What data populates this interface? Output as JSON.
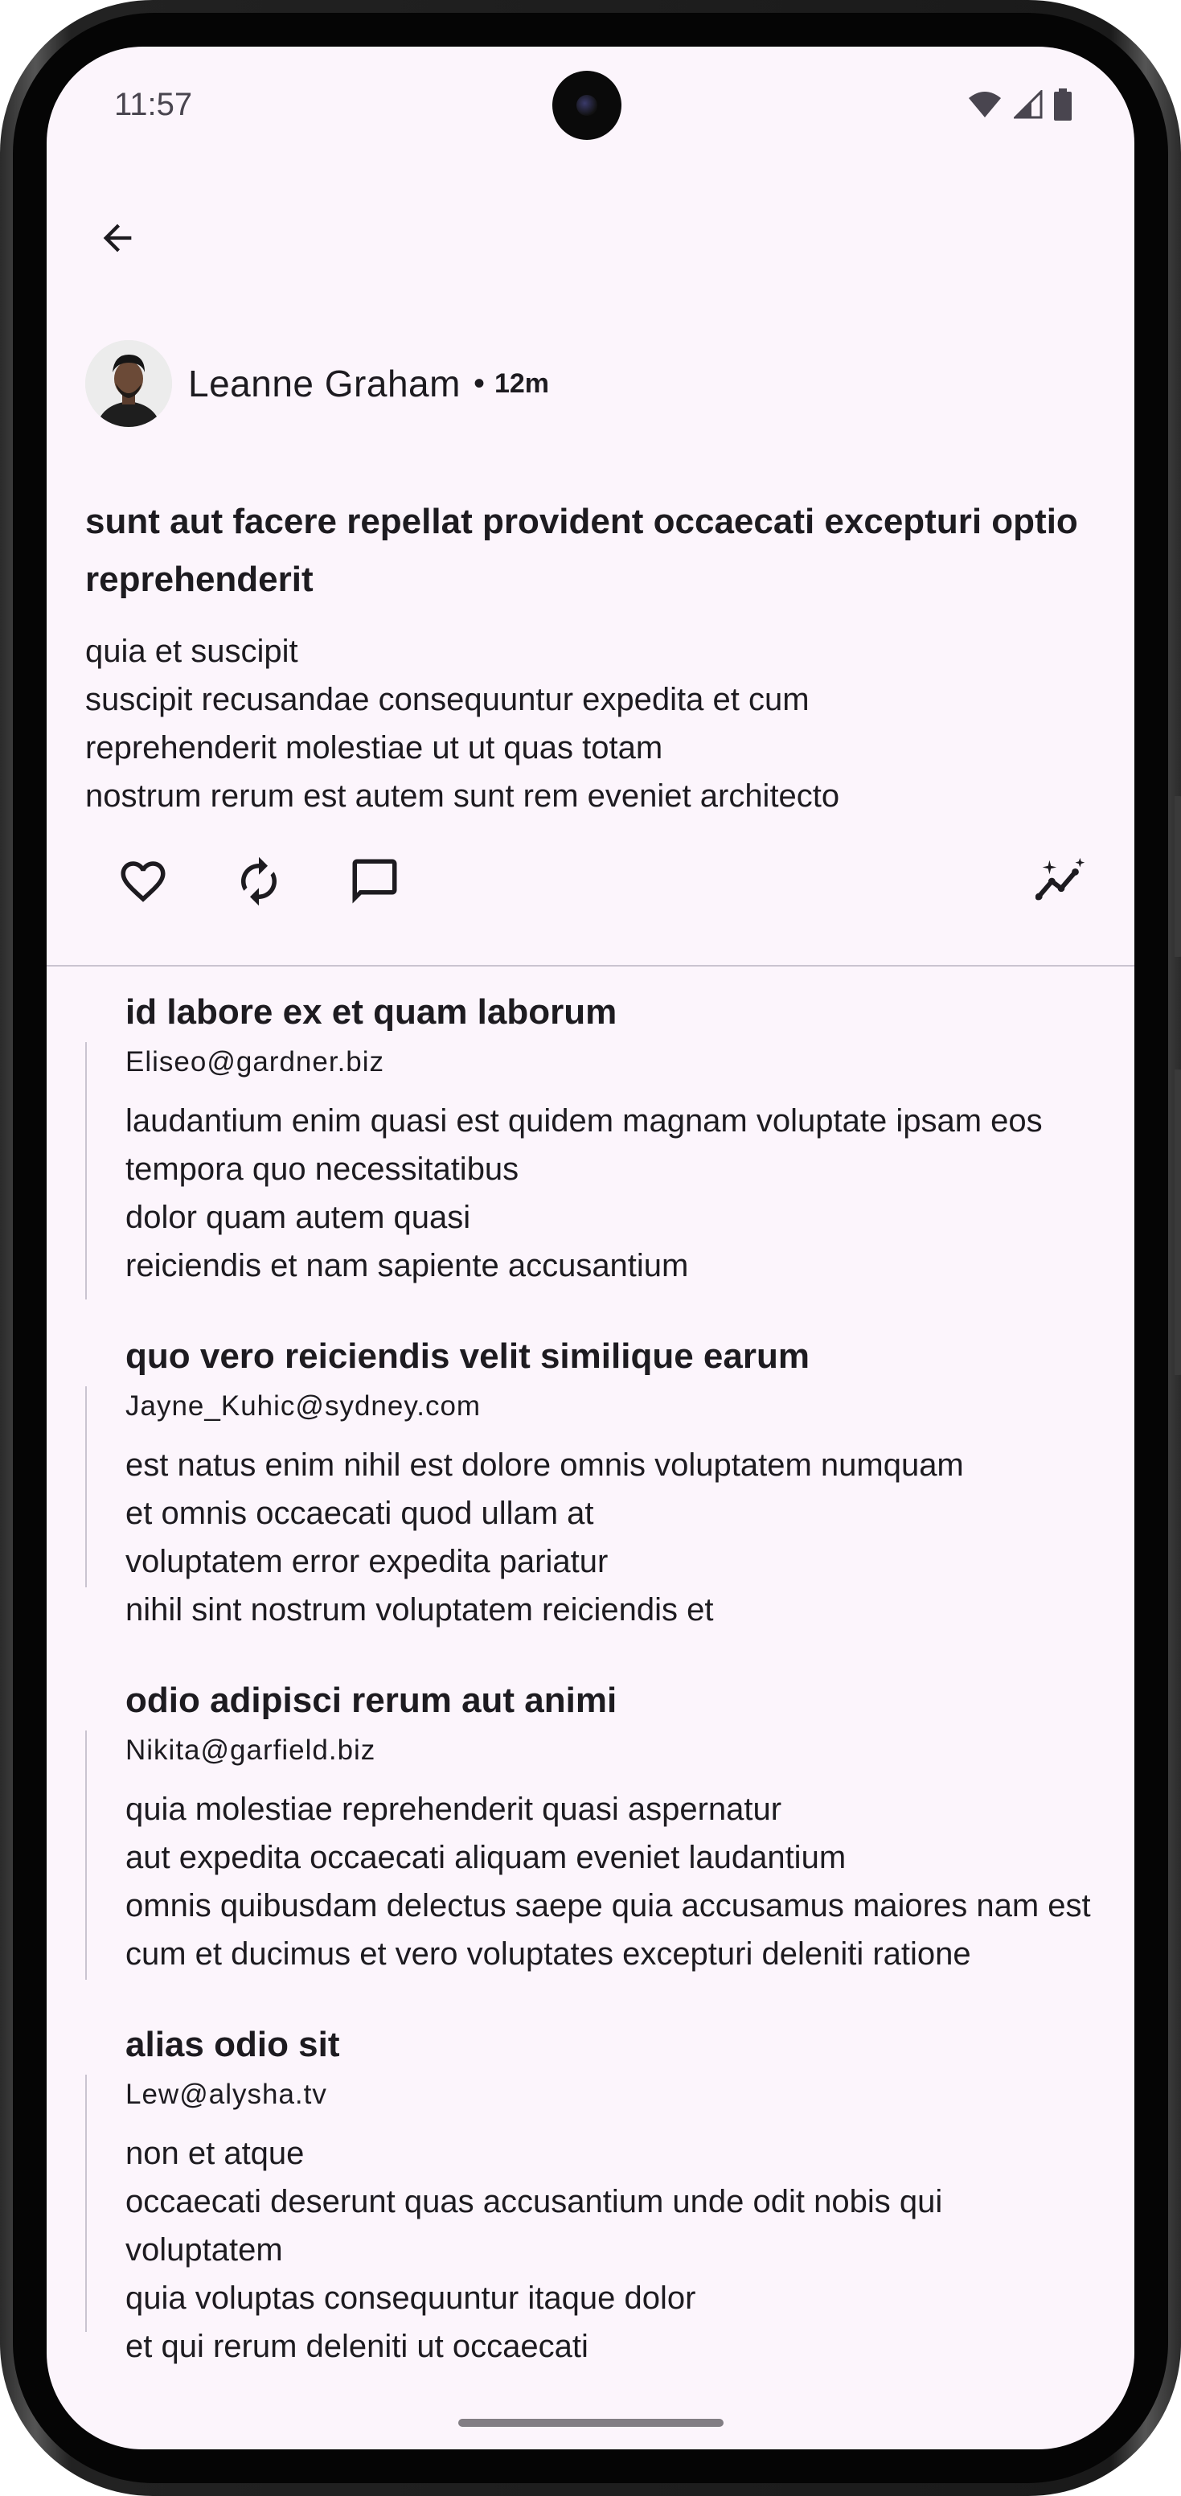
{
  "status_bar": {
    "time": "11:57"
  },
  "icons": {
    "back": "arrow-back-icon",
    "like": "heart-outline-icon",
    "repost": "repeat-icon",
    "comment": "comment-outline-icon",
    "analytics": "insights-sparkle-icon",
    "wifi": "wifi-icon",
    "signal": "signal-icon",
    "battery": "battery-icon"
  },
  "post": {
    "author": "Leanne Graham",
    "separator": "•",
    "time": "12m",
    "title": "sunt aut facere repellat provident occaecati excepturi optio reprehenderit",
    "body_lines": [
      "quia et suscipit",
      "suscipit recusandae consequuntur expedita et cum",
      "reprehenderit molestiae ut ut quas totam",
      "nostrum rerum est autem sunt rem eveniet architecto"
    ]
  },
  "comments": [
    {
      "title": "id labore ex et quam laborum",
      "email": "Eliseo@gardner.biz",
      "body_lines": [
        "laudantium enim quasi est quidem magnam voluptate ipsam eos",
        "tempora quo necessitatibus",
        "dolor quam autem quasi",
        "reiciendis et nam sapiente accusantium"
      ]
    },
    {
      "title": "quo vero reiciendis velit similique earum",
      "email": "Jayne_Kuhic@sydney.com",
      "body_lines": [
        "est natus enim nihil est dolore omnis voluptatem numquam",
        "et omnis occaecati quod ullam at",
        "voluptatem error expedita pariatur",
        "nihil sint nostrum voluptatem reiciendis et"
      ]
    },
    {
      "title": "odio adipisci rerum aut animi",
      "email": "Nikita@garfield.biz",
      "body_lines": [
        "quia molestiae reprehenderit quasi aspernatur",
        "aut expedita occaecati aliquam eveniet laudantium",
        "omnis quibusdam delectus saepe quia accusamus maiores nam est",
        "cum et ducimus et vero voluptates excepturi deleniti ratione"
      ]
    },
    {
      "title": "alias odio sit",
      "email": "Lew@alysha.tv",
      "body_lines": [
        "non et atque",
        "occaecati deserunt quas accusantium unde odit nobis qui voluptatem",
        "quia voluptas consequuntur itaque dolor",
        "et qui rerum deleniti ut occaecati"
      ]
    }
  ],
  "colors": {
    "background": "#fcf5fc",
    "text": "#1d1b20",
    "divider": "#cac4d0"
  }
}
